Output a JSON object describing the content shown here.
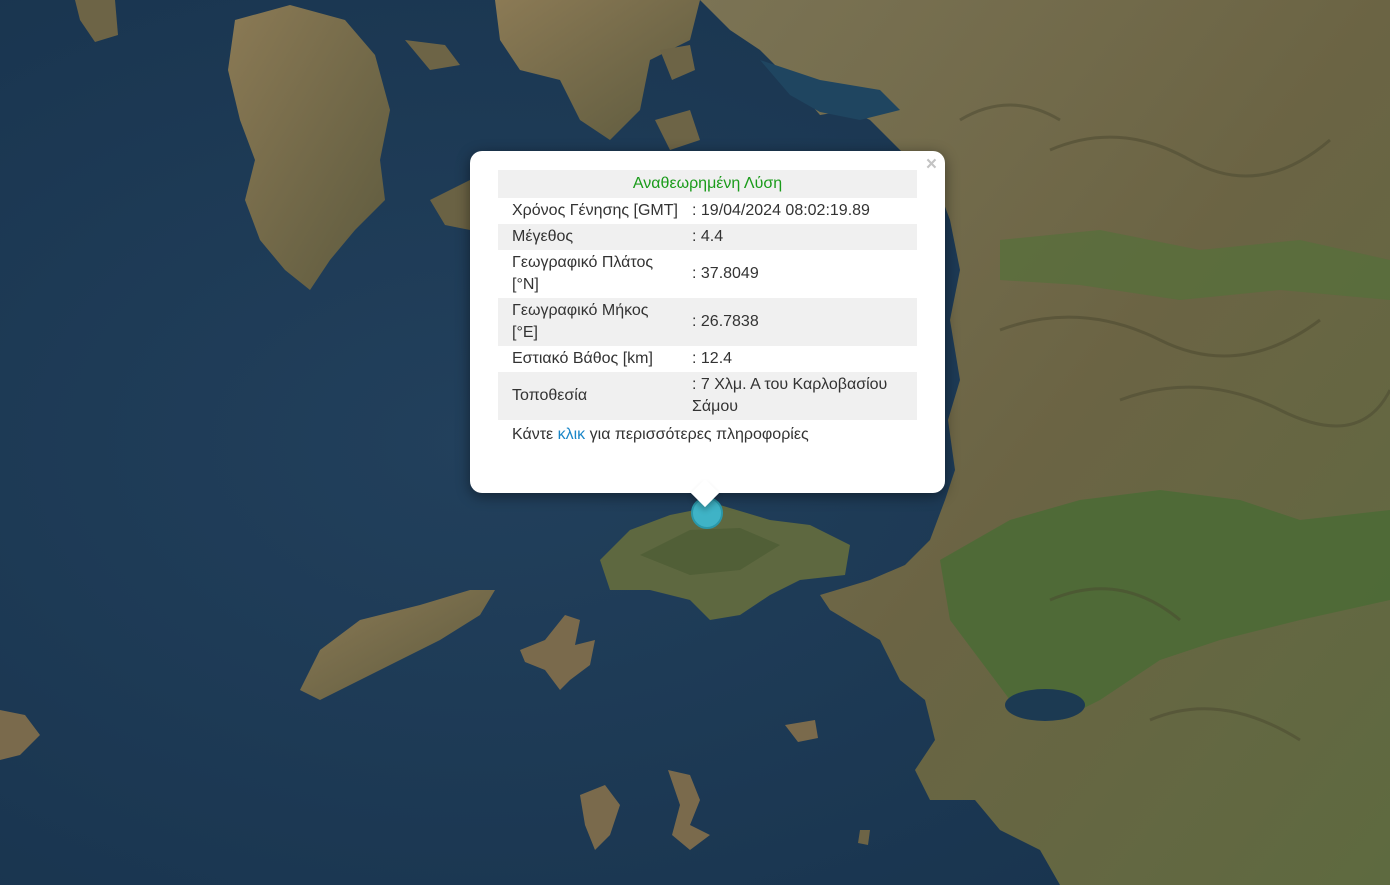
{
  "popup": {
    "title": "Αναθεωρημένη Λύση",
    "close_glyph": "×",
    "rows": [
      {
        "label": "Χρόνος Γένησης [GMT]",
        "value": ": 19/04/2024 08:02:19.89"
      },
      {
        "label": "Μέγεθος",
        "value": ": 4.4"
      },
      {
        "label": "Γεωγραφικό Πλάτος [°N]",
        "value": ": 37.8049"
      },
      {
        "label": "Γεωγραφικό Μήκος [°E]",
        "value": ": 26.7838"
      },
      {
        "label": "Εστιακό Βάθος [km]",
        "value": ": 12.4"
      },
      {
        "label": "Τοποθεσία",
        "value": ": 7 Χλμ. Α του Καρλοβασίου Σάμου"
      }
    ],
    "more_prefix": "Κάντε ",
    "more_link": "κλικ",
    "more_suffix": " για περισσότερες πληροφορίες"
  },
  "colors": {
    "sea": "#1d3a56",
    "land": "#6f6a4a",
    "land_green": "#4f6a3c",
    "marker": "#3fb3c6",
    "title_green": "#1a9b1a",
    "link_blue": "#1a86c8"
  },
  "icons": {
    "close": "close-icon",
    "marker": "earthquake-marker-icon"
  }
}
